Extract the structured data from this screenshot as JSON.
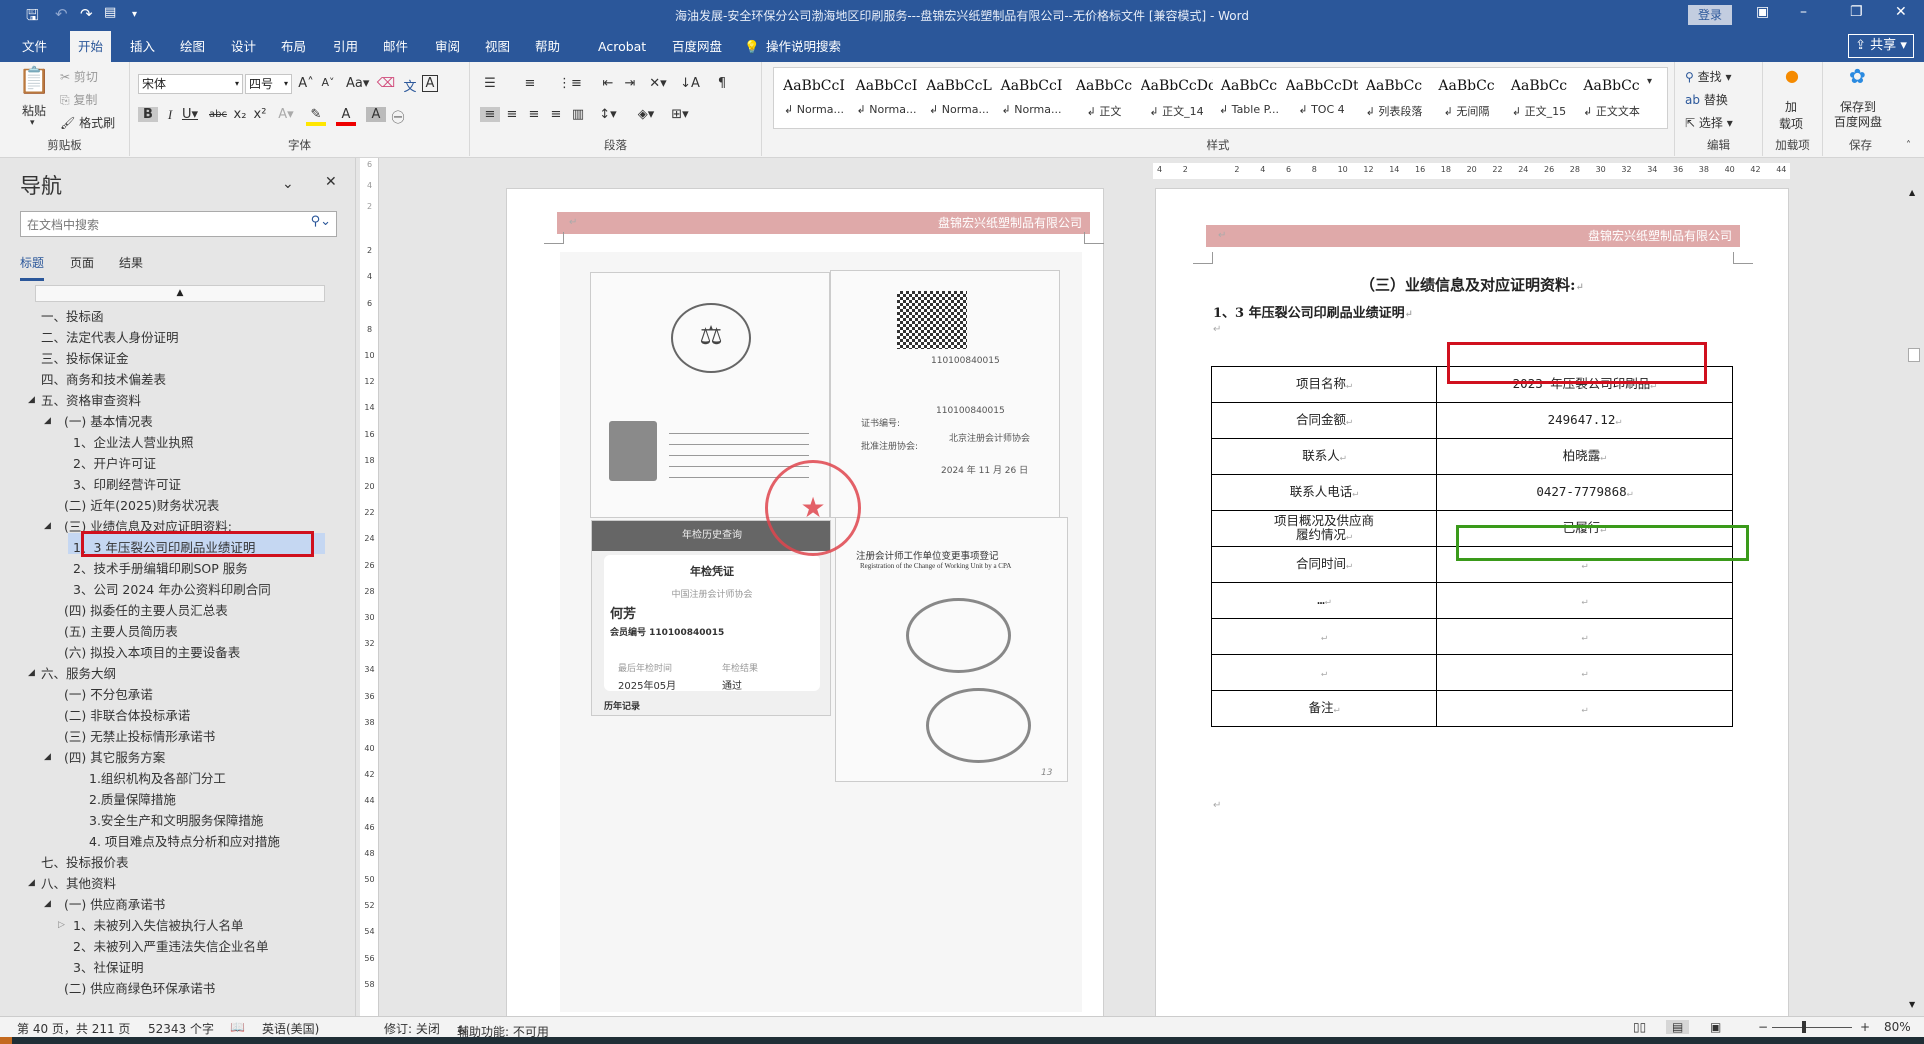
{
  "window": {
    "title": "海油发展-安全环保分公司渤海地区印刷服务---盘锦宏兴纸塑制品有限公司--无价格标文件 [兼容模式]  -  Word",
    "login": "登录"
  },
  "tabs": [
    "文件",
    "开始",
    "插入",
    "绘图",
    "设计",
    "布局",
    "引用",
    "邮件",
    "审阅",
    "视图",
    "帮助",
    "Acrobat",
    "百度网盘"
  ],
  "tell_me": "操作说明搜索",
  "share": "共享",
  "ribbon": {
    "clipboard": {
      "paste": "粘贴",
      "cut": "剪切",
      "copy": "复制",
      "format_painter": "格式刷",
      "label": "剪贴板"
    },
    "font": {
      "name": "宋体",
      "size": "四号",
      "label": "字体"
    },
    "paragraph": {
      "label": "段落"
    },
    "styles": {
      "label": "样式",
      "items": [
        {
          "preview": "AaBbCcI",
          "name": "↲ Norma..."
        },
        {
          "preview": "AaBbCcI",
          "name": "↲ Norma..."
        },
        {
          "preview": "AaBbCcL",
          "name": "↲ Norma..."
        },
        {
          "preview": "AaBbCcI",
          "name": "↲ Norma..."
        },
        {
          "preview": "AaBbCc",
          "name": "↲ 正文"
        },
        {
          "preview": "AaBbCcDd",
          "name": "↲ 正文_14"
        },
        {
          "preview": "AaBbCc",
          "name": "↲ Table P..."
        },
        {
          "preview": "AaBbCcDt",
          "name": "↲ TOC 4"
        },
        {
          "preview": "AaBbCc",
          "name": "↲ 列表段落"
        },
        {
          "preview": "AaBbCc",
          "name": "↲ 无间隔"
        },
        {
          "preview": "AaBbCc",
          "name": "↲ 正文_15"
        },
        {
          "preview": "AaBbCc",
          "name": "↲ 正文文本"
        }
      ]
    },
    "editing": {
      "find": "查找",
      "replace": "替换",
      "select": "选择",
      "label": "编辑"
    },
    "addins": {
      "button": "加\n载项",
      "label": "加载项"
    },
    "save": {
      "button1": "保存到",
      "button2": "百度网盘",
      "label": "保存"
    }
  },
  "nav": {
    "title": "导航",
    "search_placeholder": "在文档中搜索",
    "tabs": [
      "标题",
      "页面",
      "结果"
    ],
    "items": [
      {
        "label": "一、投标函",
        "indent": 1
      },
      {
        "label": "二、法定代表人身份证明",
        "indent": 1
      },
      {
        "label": "三、投标保证金",
        "indent": 1
      },
      {
        "label": "四、商务和技术偏差表",
        "indent": 1
      },
      {
        "label": "五、资格审查资料",
        "indent": 1,
        "toggle": "expanded"
      },
      {
        "label": "(一) 基本情况表",
        "indent": 2,
        "toggle": "expanded"
      },
      {
        "label": "1、企业法人营业执照",
        "indent": 3
      },
      {
        "label": "2、开户许可证",
        "indent": 3
      },
      {
        "label": "3、印刷经营许可证",
        "indent": 3
      },
      {
        "label": "(二) 近年(2025)财务状况表",
        "indent": 2
      },
      {
        "label": "(三) 业绩信息及对应证明资料:",
        "indent": 2,
        "toggle": "expanded"
      },
      {
        "label": "1、3 年压裂公司印刷品业绩证明",
        "indent": 3,
        "selected": true
      },
      {
        "label": "2、技术手册编辑印刷SOP 服务",
        "indent": 3
      },
      {
        "label": "3、公司 2024 年办公资料印刷合同",
        "indent": 3
      },
      {
        "label": "(四) 拟委任的主要人员汇总表",
        "indent": 2
      },
      {
        "label": "(五) 主要人员简历表",
        "indent": 2
      },
      {
        "label": "(六) 拟投入本项目的主要设备表",
        "indent": 2
      },
      {
        "label": "六、服务大纲",
        "indent": 1,
        "toggle": "expanded"
      },
      {
        "label": "(一) 不分包承诺",
        "indent": 2
      },
      {
        "label": "(二) 非联合体投标承诺",
        "indent": 2
      },
      {
        "label": "(三) 无禁止投标情形承诺书",
        "indent": 2
      },
      {
        "label": "(四) 其它服务方案",
        "indent": 2,
        "toggle": "expanded"
      },
      {
        "label": "1.组织机构及各部门分工",
        "indent": 4
      },
      {
        "label": "2.质量保障措施",
        "indent": 4
      },
      {
        "label": "3.安全生产和文明服务保障措施",
        "indent": 4
      },
      {
        "label": "4. 项目难点及特点分析和应对措施",
        "indent": 4
      },
      {
        "label": "七、投标报价表",
        "indent": 1
      },
      {
        "label": "八、其他资料",
        "indent": 1,
        "toggle": "expanded"
      },
      {
        "label": "(一) 供应商承诺书",
        "indent": 2,
        "toggle": "expanded"
      },
      {
        "label": "1、未被列入失信被执行人名单",
        "indent": 3,
        "toggle": "collapsed"
      },
      {
        "label": "2、未被列入严重违法失信企业名单",
        "indent": 3
      },
      {
        "label": "3、社保证明",
        "indent": 3
      },
      {
        "label": "(二) 供应商绿色环保承诺书",
        "indent": 2
      }
    ]
  },
  "ruler": {
    "h": [
      "4",
      "2",
      "",
      "2",
      "4",
      "6",
      "8",
      "10",
      "12",
      "14",
      "16",
      "18",
      "20",
      "22",
      "24",
      "26",
      "28",
      "30",
      "32",
      "34",
      "36",
      "38",
      "40",
      "42",
      "44"
    ],
    "v": [
      "6",
      "4",
      "2",
      "",
      "2",
      "4",
      "6",
      "8",
      "10",
      "12",
      "14",
      "16",
      "18",
      "20",
      "22",
      "24",
      "26",
      "28",
      "30",
      "32",
      "34",
      "36",
      "38",
      "40",
      "42",
      "44",
      "46",
      "48",
      "50",
      "52",
      "54",
      "56",
      "58"
    ]
  },
  "page1": {
    "header_company": "盘锦宏兴纸塑制品有限公司",
    "cert": {
      "cert_no_label": "证书编号:",
      "cert_no": "110100840015",
      "institute_label": "批准注册协会:",
      "institute": "北京注册会计师协会",
      "issue_date": "2024 年 11 月 26 日",
      "history_header": "年检历史查询",
      "card_title": "年检凭证",
      "card_org": "中国注册会计师协会",
      "name": "何芳",
      "member_no": "会员编号 110100840015",
      "last_check_label": "最后年检时间",
      "last_check": "2025年05月",
      "result_label": "年检结果",
      "result": "通过",
      "history": "历年记录",
      "change_title": "注册会计师工作单位变更事项登记",
      "change_title_en": "Registration of the Change of Working Unit by a CPA",
      "page_no": "13"
    }
  },
  "page2": {
    "header_company": "盘锦宏兴纸塑制品有限公司",
    "section_title": "（三）业绩信息及对应证明资料:",
    "subheading": "1、3 年压裂公司印刷品业绩证明",
    "table": [
      [
        "项目名称",
        "2023  年压裂公司印刷品"
      ],
      [
        "合同金额",
        "249647.12"
      ],
      [
        "联系人",
        "柏晓露"
      ],
      [
        "联系人电话",
        "0427-7779868"
      ],
      [
        "项目概况及供应商\n履约情况",
        "已履行"
      ],
      [
        "合同时间",
        ""
      ],
      [
        "…",
        ""
      ],
      [
        "",
        ""
      ],
      [
        "",
        ""
      ],
      [
        "备注",
        ""
      ]
    ]
  },
  "status": {
    "page": "第 40 页，共 211 页",
    "words": "52343 个字",
    "language": "英语(美国)",
    "track": "修订: 关闭",
    "accessibility": "辅助功能: 不可用",
    "zoom": "80%",
    "zoom_percent": 80
  }
}
